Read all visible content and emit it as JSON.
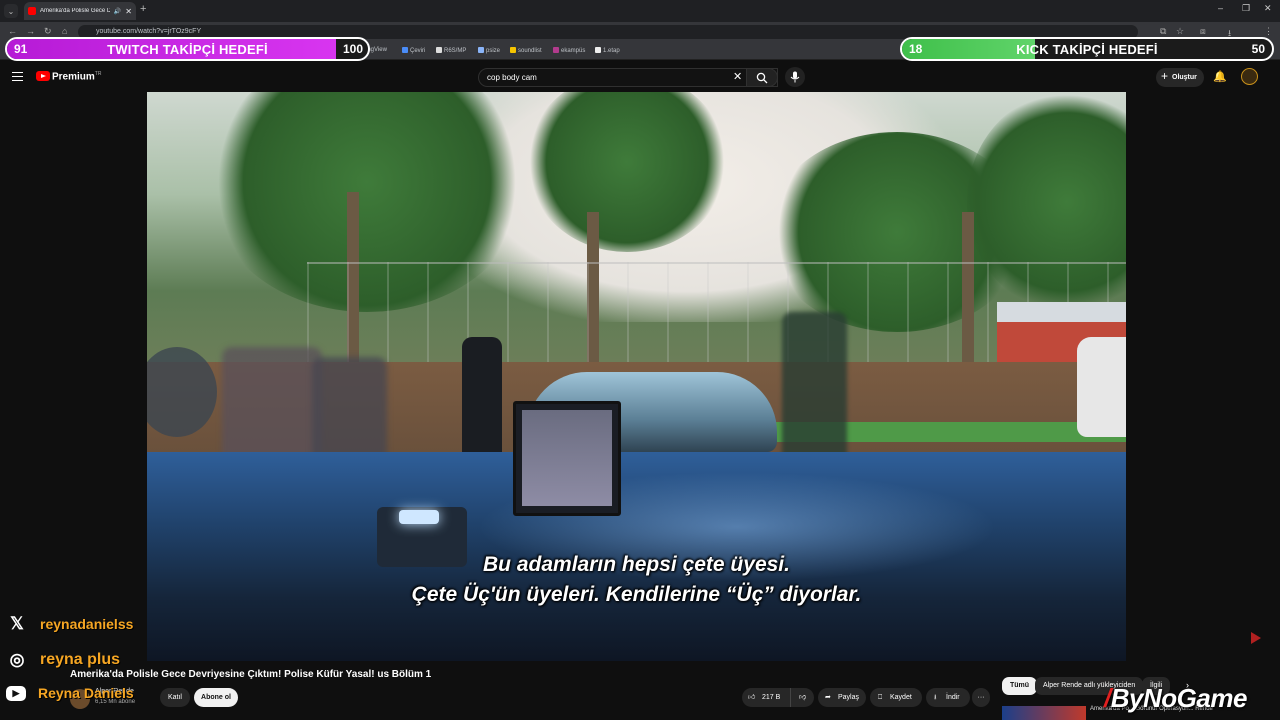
{
  "browser": {
    "tab_title": "Amerika'da Polisle Gece Dev",
    "url": "youtube.com/watch?v=jrTOz9cFY",
    "bookmarks": [
      "ingView",
      "Çeviri",
      "R6S/MP",
      "psize",
      "soundlist",
      "ekampüs",
      "1.etap"
    ]
  },
  "overlay": {
    "twitch_goal": {
      "current": "91",
      "target": "100",
      "label": "TWITCH TAKİPÇİ HEDEFİ",
      "progress": 0.91
    },
    "kick_goal": {
      "current": "18",
      "target": "50",
      "label": "KICK TAKİPÇİ HEDEFİ",
      "progress": 0.36
    },
    "socials": [
      {
        "icon": "x-icon",
        "glyph": "𝕏",
        "handle": "reynadanielss"
      },
      {
        "icon": "instagram-icon",
        "glyph": "◎",
        "handle": "reyna plus"
      },
      {
        "icon": "youtube-icon",
        "glyph": "▶",
        "handle": "Reyna Daniels"
      }
    ],
    "sponsor": {
      "prefix": "By",
      "name": "NoGame"
    }
  },
  "youtube": {
    "logo_text": "Premium",
    "logo_sup": "TR",
    "search_query": "cop body cam",
    "create_label": "Oluştur",
    "video": {
      "subtitle_line1": "Bu adamların hepsi çete üyesi.",
      "subtitle_line2": "Çete Üç'ün üyeleri. Kendilerine “Üç” diyorlar.",
      "title": "Amerika'da Polisle Gece Devriyesine Çıktım! Polise Küfür Yasal! us Bölüm 1",
      "channel": "Alper Rende",
      "subscribers": "6,15 Mn abone",
      "join_label": "Katıl",
      "subscribe_label": "Abone ol",
      "like_count": "217 B",
      "share_label": "Paylaş",
      "save_label": "Kaydet",
      "download_label": "İndir",
      "more_glyph": "···"
    },
    "chips": [
      "Tümü",
      "Alper Rende adlı yükleyiciden",
      "İlgili"
    ],
    "next_thumb_text": "Amerika'da Po... Görünür Operasyon... Rende"
  }
}
